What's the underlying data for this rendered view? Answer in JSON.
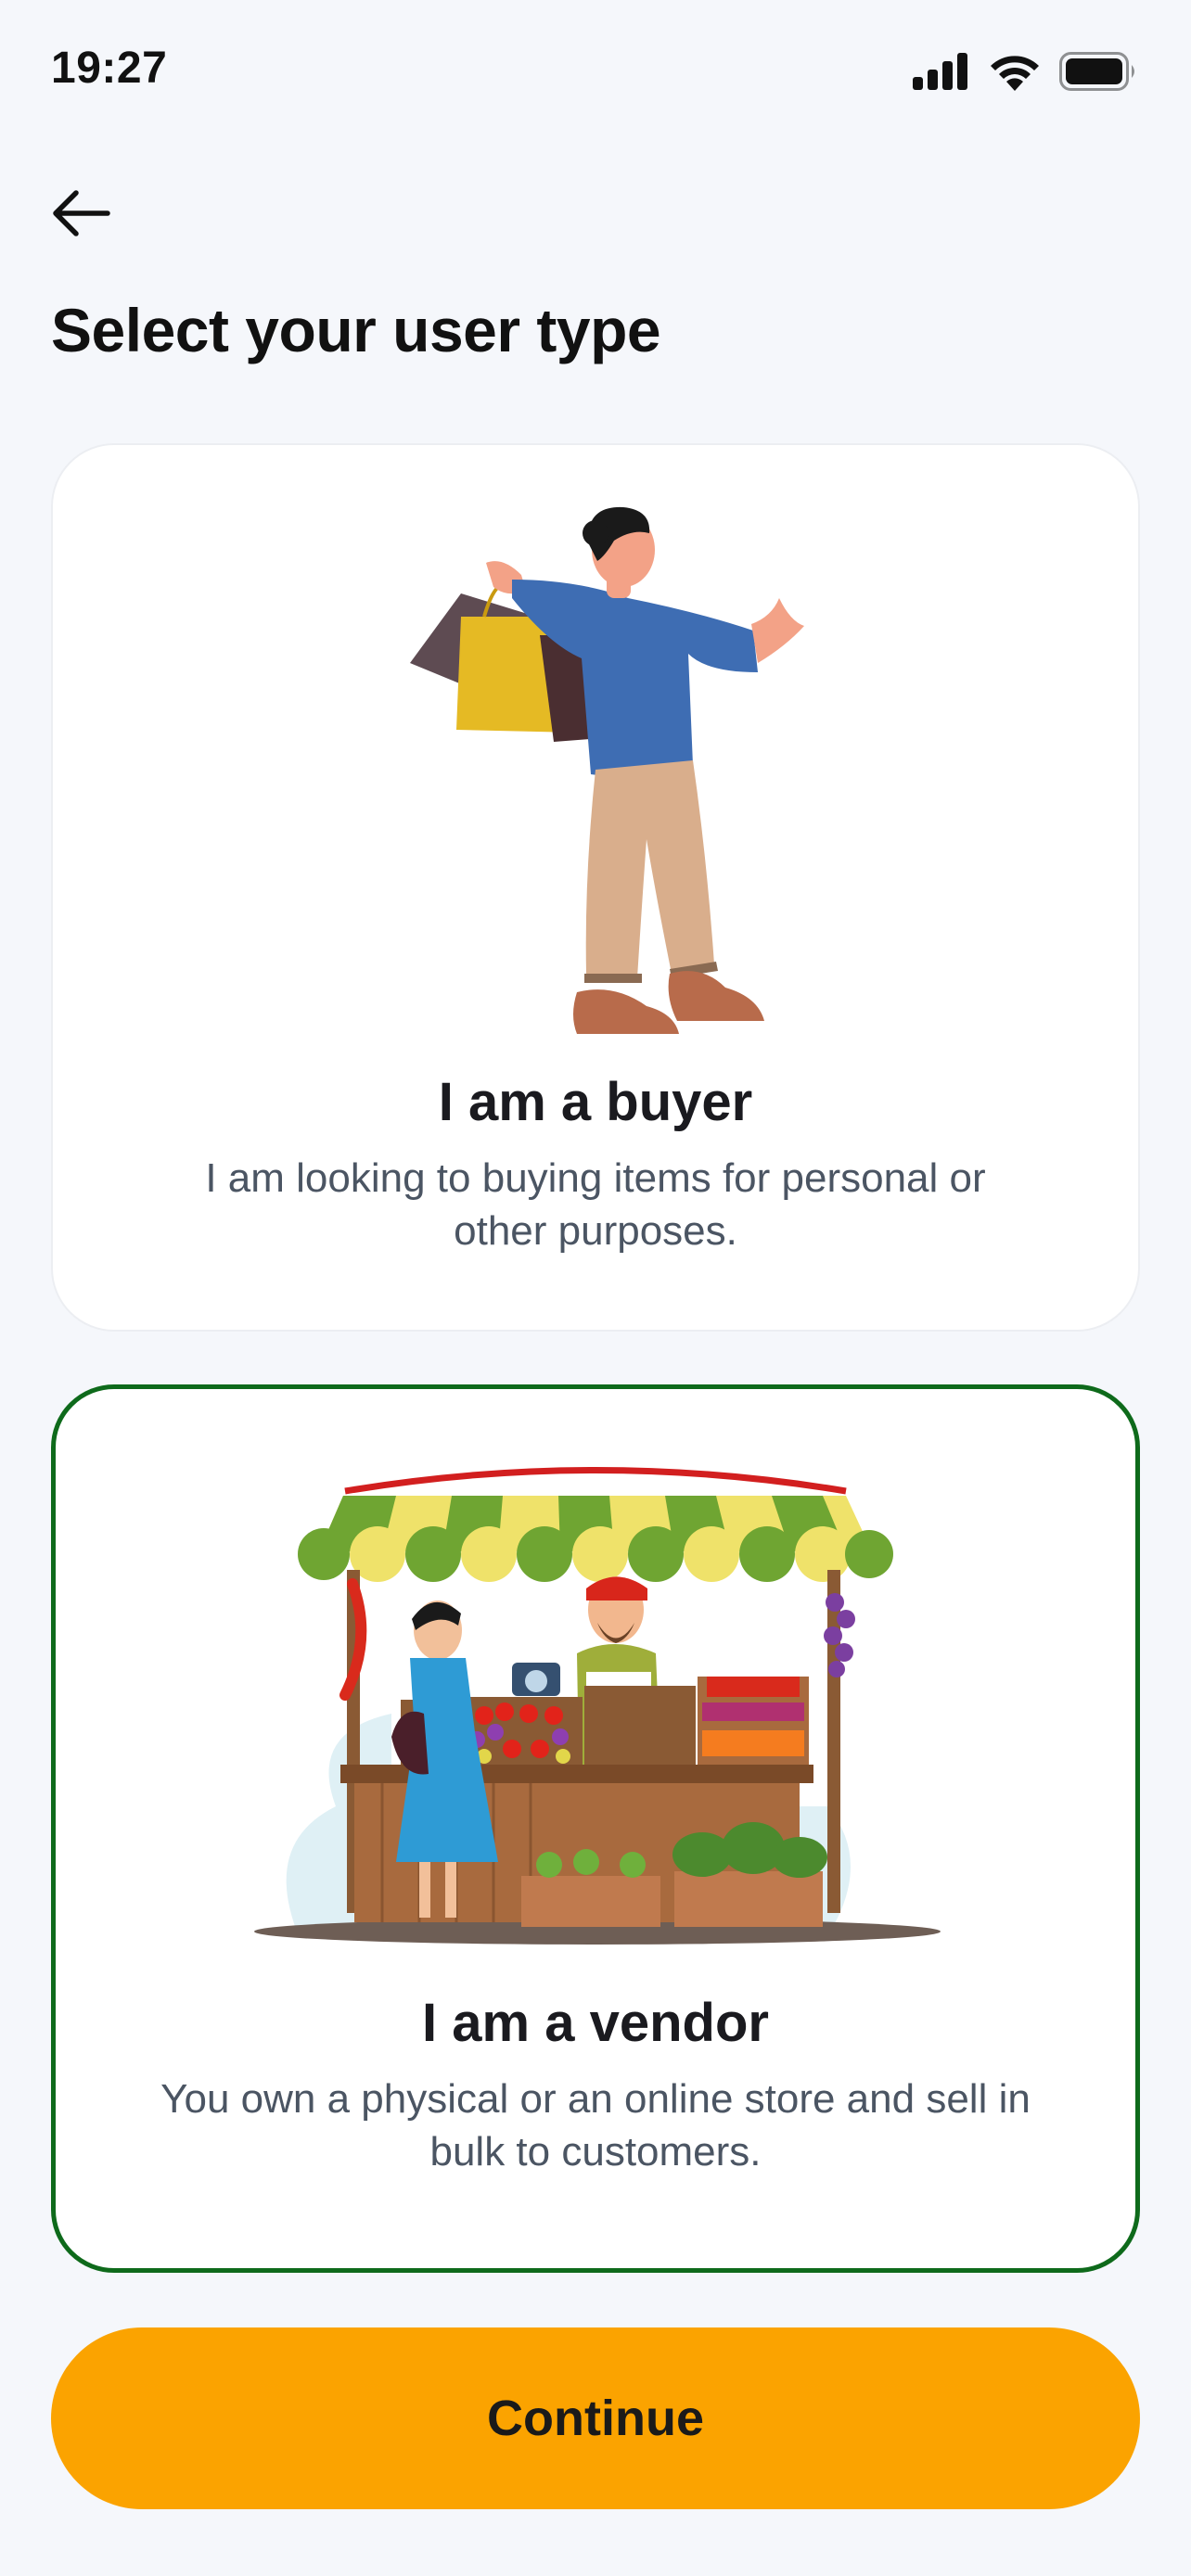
{
  "status_bar": {
    "time": "19:27",
    "icons": [
      "cellular-signal-icon",
      "wifi-icon",
      "battery-icon"
    ]
  },
  "header": {
    "back_icon": "arrow-left-icon",
    "title": "Select your user type"
  },
  "options": [
    {
      "id": "buyer",
      "title": "I am a buyer",
      "description": "I am looking to buying items for personal or other purposes.",
      "selected": false,
      "illustration": "shopper-with-bags"
    },
    {
      "id": "vendor",
      "title": "I am a vendor",
      "description": "You own a physical or an online store and sell in bulk to customers.",
      "selected": true,
      "illustration": "market-stall"
    }
  ],
  "actions": {
    "continue_label": "Continue"
  },
  "colors": {
    "background": "#F5F7FB",
    "card": "#FFFFFF",
    "selected_border": "#0E6A1B",
    "primary_button": "#FBA300",
    "description_text": "#4B5563"
  }
}
